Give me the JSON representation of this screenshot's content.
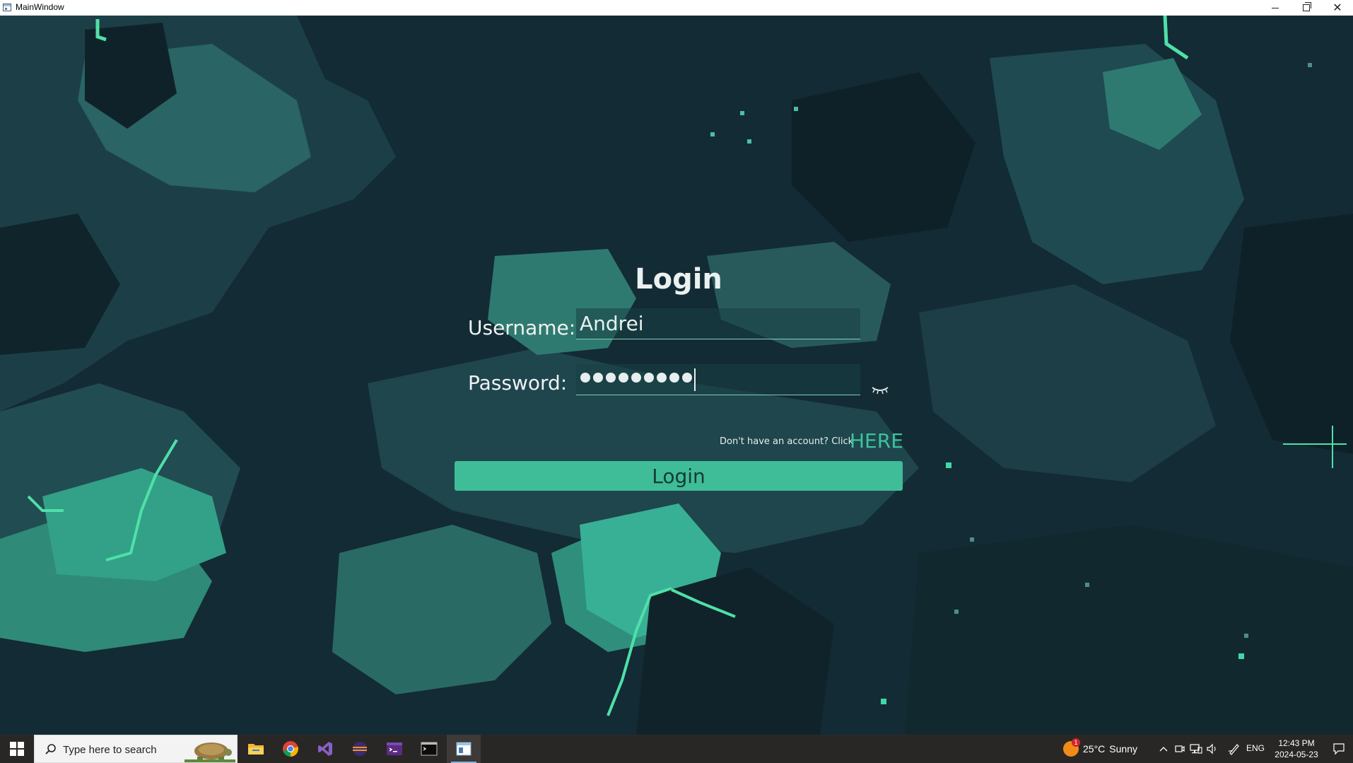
{
  "window": {
    "title": "MainWindow",
    "minimize_glyph": "",
    "close_glyph": "✕"
  },
  "login": {
    "title": "Login",
    "username_label": "Username:",
    "username_value": "Andrei",
    "password_label": "Password:",
    "password_masked_length": 9,
    "show_password_icon": "closed-eye-icon",
    "signup_prompt": "Don't have an account? Click",
    "signup_link": "HERE",
    "login_button": "Login"
  },
  "taskbar": {
    "search_placeholder": "Type here to search",
    "apps": [
      {
        "name": "file-explorer",
        "icon": "folder-icon"
      },
      {
        "name": "chrome",
        "icon": "chrome-icon"
      },
      {
        "name": "visual-studio",
        "icon": "visual-studio-icon"
      },
      {
        "name": "eclipse",
        "icon": "eclipse-icon"
      },
      {
        "name": "terminal-purple",
        "icon": "terminal-icon"
      },
      {
        "name": "command-prompt",
        "icon": "cmd-icon"
      },
      {
        "name": "mainwindow-app",
        "icon": "app-window-icon"
      }
    ],
    "weather": {
      "temperature": "25°C",
      "condition": "Sunny",
      "badge": "1"
    },
    "language": "ENG",
    "time": "12:43 PM",
    "date": "2024-05-23"
  },
  "colors": {
    "accent": "#3fbd98",
    "link": "#3ec39d",
    "background_dark": "#132b34",
    "taskbar": "#292725"
  }
}
